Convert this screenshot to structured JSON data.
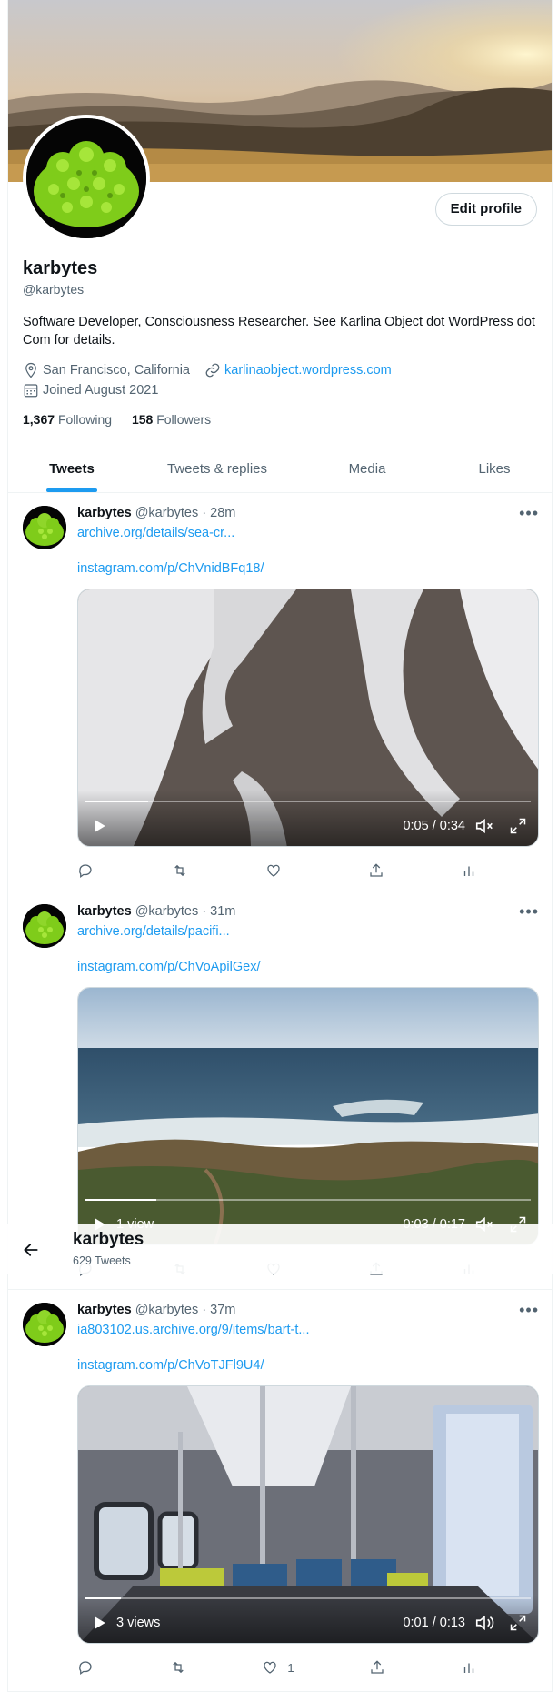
{
  "profile": {
    "name": "karbytes",
    "handle": "@karbytes",
    "edit_profile_label": "Edit profile",
    "bio": "Software Developer, Consciousness Researcher. See Karlina Object dot WordPress dot Com for details.",
    "location": "San Francisco, California",
    "website": "karlinaobject.wordpress.com",
    "joined": "Joined August 2021",
    "following_count": "1,367",
    "following_label": "Following",
    "followers_count": "158",
    "followers_label": "Followers"
  },
  "tabs": [
    {
      "label": "Tweets",
      "active": true
    },
    {
      "label": "Tweets & replies",
      "active": false
    },
    {
      "label": "Media",
      "active": false
    },
    {
      "label": "Likes",
      "active": false
    }
  ],
  "sticky_header": {
    "name": "karbytes",
    "tweet_count": "629 Tweets"
  },
  "tweets": [
    {
      "name": "karbytes",
      "handle": "@karbytes",
      "sep": "·",
      "time": "28m",
      "link1": "archive.org/details/sea-cr...",
      "link2": "instagram.com/p/ChVnidBFq18/",
      "video": {
        "views": "",
        "time": "0:05 / 0:34",
        "muted": true,
        "progress": 0.14
      },
      "like_count": ""
    },
    {
      "name": "karbytes",
      "handle": "@karbytes",
      "sep": "·",
      "time": "31m",
      "link1": "archive.org/details/pacifi...",
      "link2": "instagram.com/p/ChVoApilGex/",
      "video": {
        "views": "1 view",
        "time": "0:03 / 0:17",
        "muted": true,
        "progress": 0.16
      },
      "like_count": ""
    },
    {
      "name": "karbytes",
      "handle": "@karbytes",
      "sep": "·",
      "time": "37m",
      "link1": "ia803102.us.archive.org/9/items/bart-t...",
      "link2": "instagram.com/p/ChVoTJFl9U4/",
      "video": {
        "views": "3 views",
        "time": "0:01 / 0:13",
        "muted": false,
        "progress": 0.08
      },
      "like_count": "1"
    }
  ],
  "icons": {
    "more": "more-icon",
    "reply": "reply-icon",
    "retweet": "retweet-icon",
    "like": "heart-icon",
    "share": "share-icon",
    "analytics": "analytics-icon"
  },
  "colors": {
    "accent": "#1d9bf0",
    "text": "#0f1419",
    "muted": "#536471"
  }
}
